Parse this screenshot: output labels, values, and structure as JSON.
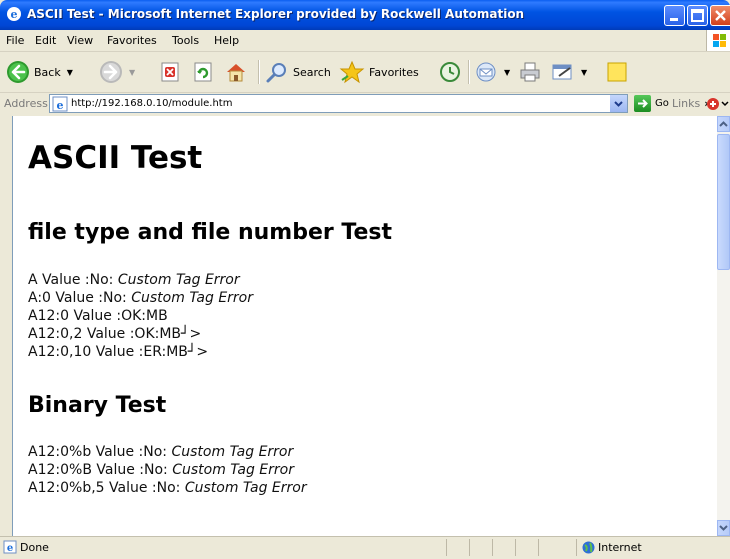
{
  "window": {
    "title": "ASCII Test - Microsoft Internet Explorer provided by Rockwell Automation"
  },
  "menu": [
    "File",
    "Edit",
    "View",
    "Favorites",
    "Tools",
    "Help"
  ],
  "toolbar": {
    "back_label": "Back",
    "search_label": "Search",
    "favorites_label": "Favorites"
  },
  "address": {
    "label": "Address",
    "url": "http://192.168.0.10/module.htm",
    "go_label": "Go",
    "links_label": "Links"
  },
  "page": {
    "heading": "ASCII Test",
    "sections": [
      {
        "title": "file type and file number Test",
        "lines": [
          {
            "text": "A Value :No: ",
            "italic": "Custom Tag Error"
          },
          {
            "text": "A:0 Value :No: ",
            "italic": "Custom Tag Error"
          },
          {
            "text": "A12:0 Value :OK:MB",
            "italic": ""
          },
          {
            "text": "A12:0,2 Value :OK:MB┘>",
            "italic": ""
          },
          {
            "text": "A12:0,10 Value :ER:MB┘>",
            "italic": ""
          }
        ]
      },
      {
        "title": "Binary Test",
        "lines": [
          {
            "text": "A12:0%b Value :No: ",
            "italic": "Custom Tag Error"
          },
          {
            "text": "A12:0%B Value :No: ",
            "italic": "Custom Tag Error"
          },
          {
            "text": "A12:0%b,5 Value :No: ",
            "italic": "Custom Tag Error"
          }
        ]
      }
    ]
  },
  "status": {
    "text": "Done",
    "zone": "Internet"
  },
  "colors": {
    "titlebar": "#0054E3",
    "chrome": "#ECE9D8",
    "content_bg": "#FFFFFF"
  }
}
